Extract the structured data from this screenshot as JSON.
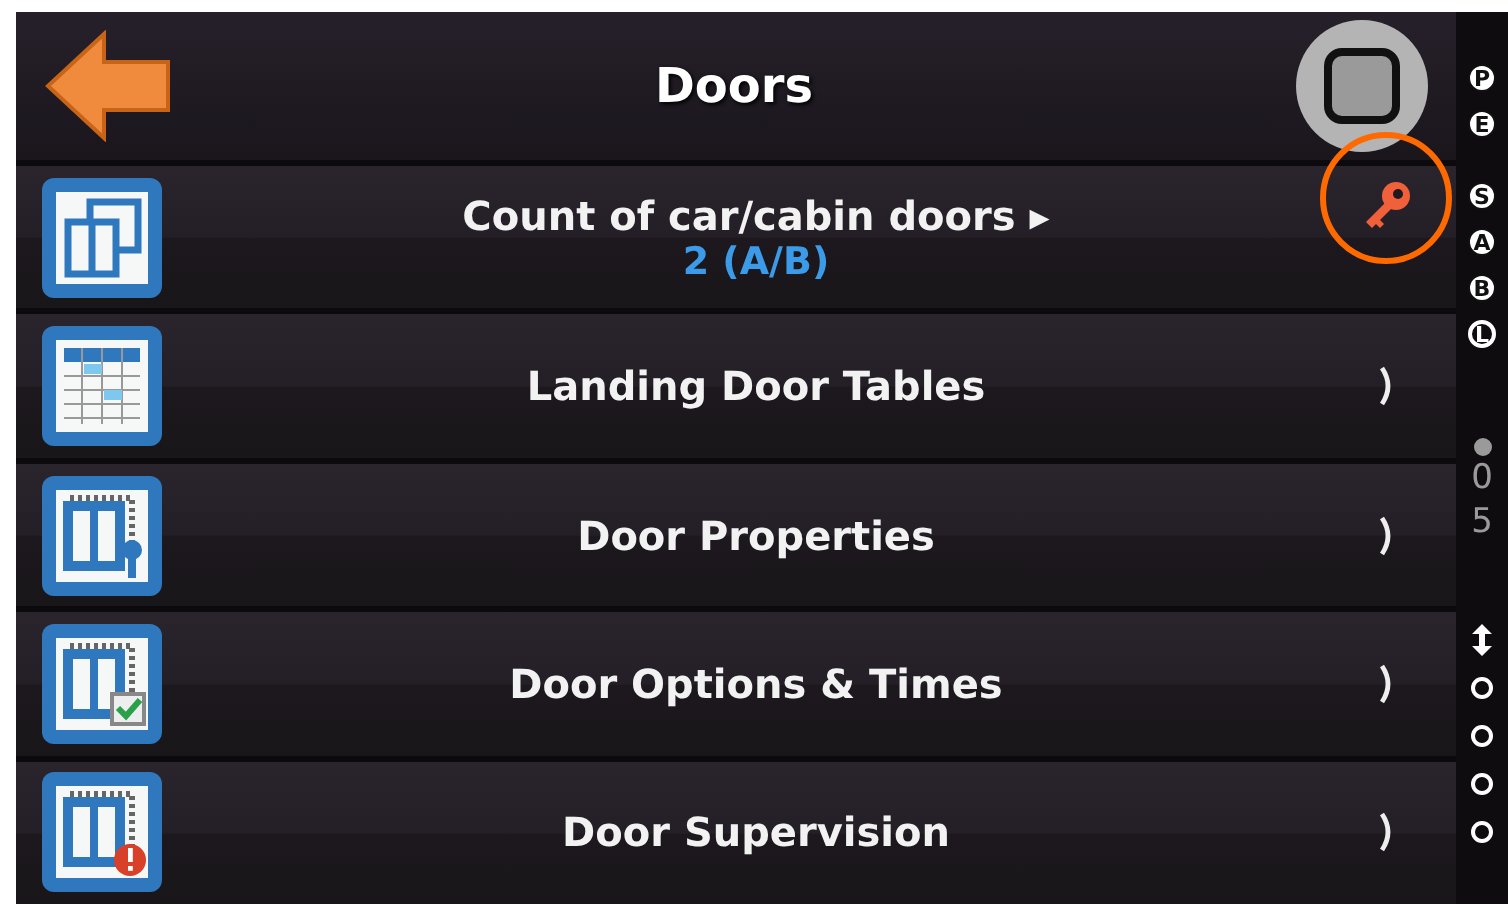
{
  "header": {
    "title": "Doors"
  },
  "rows": [
    {
      "kind": "doors",
      "label": "Count of car/cabin doors",
      "marker": "▸",
      "value": "2 (A/B)",
      "locked": true
    },
    {
      "kind": "table",
      "label": "Landing Door Tables",
      "chevron": true
    },
    {
      "kind": "properties",
      "label": "Door Properties",
      "chevron": true
    },
    {
      "kind": "options",
      "label": "Door Options & Times",
      "chevron": true
    },
    {
      "kind": "supervision",
      "label": "Door Supervision",
      "chevron": true
    }
  ],
  "side": {
    "badges": [
      {
        "letter": "P",
        "filled": true
      },
      {
        "letter": "E",
        "filled": true
      },
      {
        "letter": "S",
        "filled": true
      },
      {
        "letter": "A",
        "filled": true
      },
      {
        "letter": "B",
        "filled": true
      },
      {
        "letter": "L",
        "filled": false
      }
    ],
    "digits": [
      "0",
      "5"
    ],
    "slots": [
      {
        "kind": "empty"
      },
      {
        "kind": "empty"
      },
      {
        "kind": "empty"
      },
      {
        "kind": "empty"
      }
    ]
  }
}
